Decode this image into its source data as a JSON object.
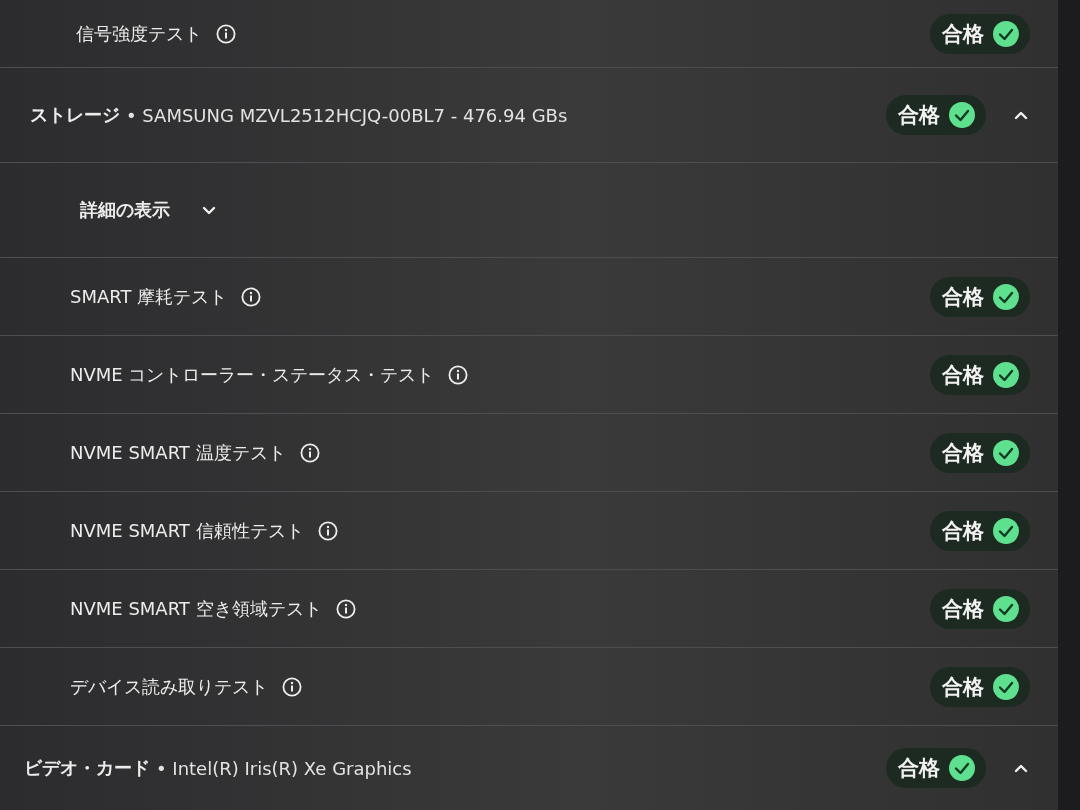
{
  "rows": [
    {
      "kind": "test",
      "label": "信号強度テスト",
      "result": "合格",
      "passed": true
    },
    {
      "kind": "section",
      "category": "ストレージ",
      "detail": "• SAMSUNG MZVL2512HCJQ-00BL7 - 476.94 GBs",
      "result": "合格",
      "passed": true,
      "expanded": true
    },
    {
      "kind": "details",
      "label": "詳細の表示",
      "expanded": false
    },
    {
      "kind": "test",
      "label": "SMART 摩耗テスト",
      "result": "合格",
      "passed": true
    },
    {
      "kind": "test",
      "label": "NVME コントローラー・ステータス・テスト",
      "result": "合格",
      "passed": true
    },
    {
      "kind": "test",
      "label": "NVME SMART 温度テスト",
      "result": "合格",
      "passed": true
    },
    {
      "kind": "test",
      "label": "NVME SMART 信頼性テスト",
      "result": "合格",
      "passed": true
    },
    {
      "kind": "test",
      "label": "NVME SMART 空き領域テスト",
      "result": "合格",
      "passed": true
    },
    {
      "kind": "test",
      "label": "デバイス読み取りテスト",
      "result": "合格",
      "passed": true
    },
    {
      "kind": "section",
      "category": "ビデオ・カード",
      "detail": "• Intel(R) Iris(R) Xe Graphics",
      "result": "合格",
      "passed": true,
      "expanded": true
    }
  ]
}
